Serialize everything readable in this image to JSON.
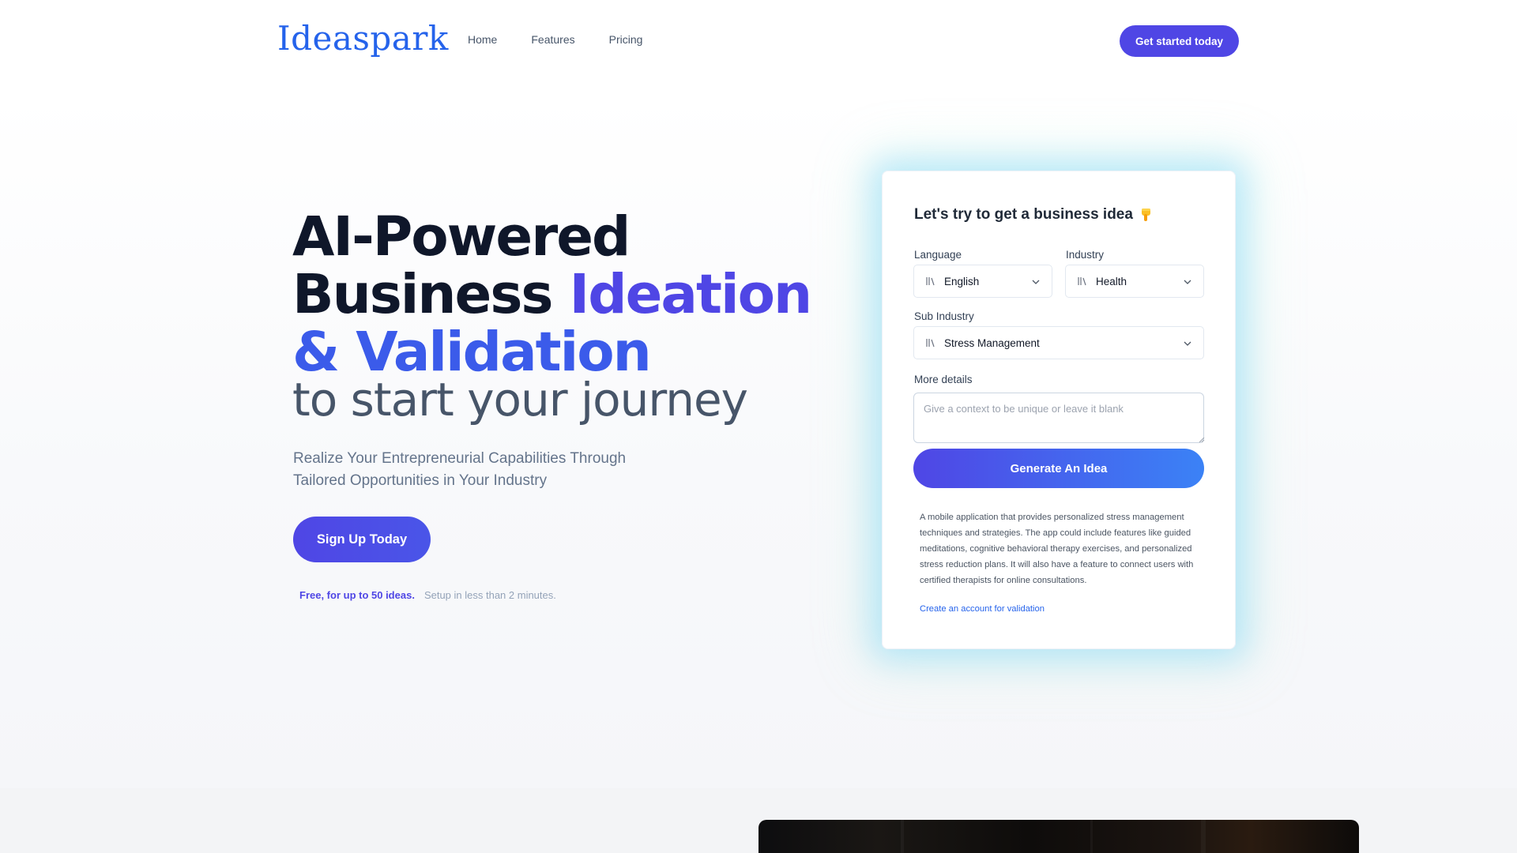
{
  "nav": {
    "logo": "Ideaspark",
    "links": [
      "Home",
      "Features",
      "Pricing"
    ],
    "cta": "Get started today"
  },
  "hero": {
    "line1": "AI-Powered",
    "line2_plain": "Business ",
    "line2_accent": "Ideation",
    "line3_accent": "& Validation",
    "line4": "to start your journey",
    "lead_line1": "Realize Your Entrepreneurial Capabilities Through",
    "lead_line2": "Tailored Opportunities in Your Industry",
    "signup": "Sign Up Today",
    "free_note": "Free, for up to 50 ideas.",
    "setup_note": "Setup in less than 2 minutes."
  },
  "card": {
    "title": "Let's try to get a business idea",
    "language_label": "Language",
    "language_value": "English",
    "industry_label": "Industry",
    "industry_value": "Health",
    "sub_industry_label": "Sub Industry",
    "sub_industry_value": "Stress Management",
    "details_label": "More details",
    "details_placeholder": "Give a context to be unique or leave it blank",
    "generate": "Generate An Idea",
    "result": "A mobile application that provides personalized stress management techniques and strategies. The app could include features like guided meditations, cognitive behavioral therapy exercises, and personalized stress reduction plans. It will also have a feature to connect users with certified therapists for online consultations.",
    "result_link": "Create an account for validation"
  },
  "colors": {
    "brand": "#4f46e5",
    "accent_blue": "#3b82f6",
    "logo": "#2563eb"
  }
}
